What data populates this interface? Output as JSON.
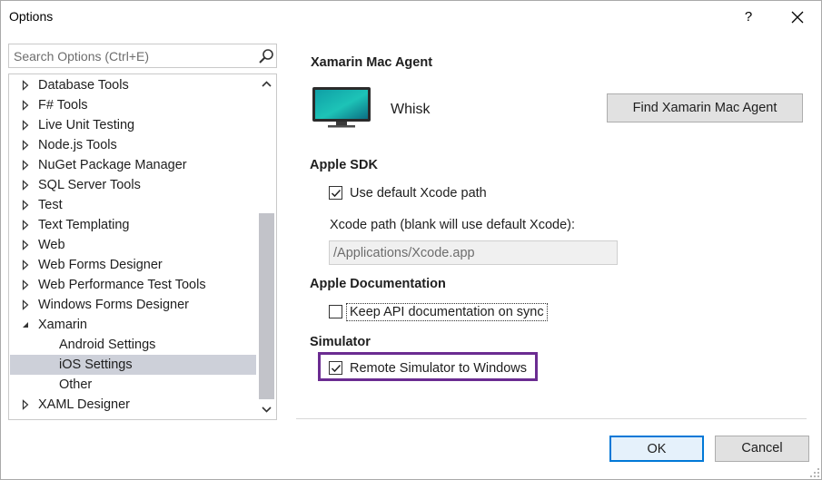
{
  "window": {
    "title": "Options",
    "help_label": "?"
  },
  "search": {
    "placeholder": "Search Options (Ctrl+E)"
  },
  "tree": {
    "items": [
      {
        "label": "Database Tools",
        "expandable": true,
        "expanded": false,
        "level": 0
      },
      {
        "label": "F# Tools",
        "expandable": true,
        "expanded": false,
        "level": 0
      },
      {
        "label": "Live Unit Testing",
        "expandable": true,
        "expanded": false,
        "level": 0
      },
      {
        "label": "Node.js Tools",
        "expandable": true,
        "expanded": false,
        "level": 0
      },
      {
        "label": "NuGet Package Manager",
        "expandable": true,
        "expanded": false,
        "level": 0
      },
      {
        "label": "SQL Server Tools",
        "expandable": true,
        "expanded": false,
        "level": 0
      },
      {
        "label": "Test",
        "expandable": true,
        "expanded": false,
        "level": 0
      },
      {
        "label": "Text Templating",
        "expandable": true,
        "expanded": false,
        "level": 0
      },
      {
        "label": "Web",
        "expandable": true,
        "expanded": false,
        "level": 0
      },
      {
        "label": "Web Forms Designer",
        "expandable": true,
        "expanded": false,
        "level": 0
      },
      {
        "label": "Web Performance Test Tools",
        "expandable": true,
        "expanded": false,
        "level": 0
      },
      {
        "label": "Windows Forms Designer",
        "expandable": true,
        "expanded": false,
        "level": 0
      },
      {
        "label": "Xamarin",
        "expandable": true,
        "expanded": true,
        "level": 0
      },
      {
        "label": "Android Settings",
        "expandable": false,
        "expanded": false,
        "level": 1
      },
      {
        "label": "iOS Settings",
        "expandable": false,
        "expanded": false,
        "level": 1,
        "selected": true
      },
      {
        "label": "Other",
        "expandable": false,
        "expanded": false,
        "level": 1
      },
      {
        "label": "XAML Designer",
        "expandable": true,
        "expanded": false,
        "level": 0
      }
    ]
  },
  "mac_agent": {
    "heading": "Xamarin Mac Agent",
    "agent_name": "Whisk",
    "find_button": "Find Xamarin Mac Agent"
  },
  "apple_sdk": {
    "heading": "Apple SDK",
    "use_default_label": "Use default Xcode path",
    "use_default_checked": true,
    "xcode_path_label": "Xcode path (blank will use default Xcode):",
    "xcode_path_value": "/Applications/Xcode.app"
  },
  "apple_docs": {
    "heading": "Apple Documentation",
    "keep_docs_label": "Keep API documentation on sync",
    "keep_docs_checked": false
  },
  "simulator": {
    "heading": "Simulator",
    "remote_label": "Remote Simulator to Windows",
    "remote_checked": true
  },
  "footer": {
    "ok_label": "OK",
    "cancel_label": "Cancel"
  },
  "colors": {
    "highlight_border": "#6b2c91",
    "ok_border": "#0078d7",
    "selected_row": "#cdd0d9"
  }
}
